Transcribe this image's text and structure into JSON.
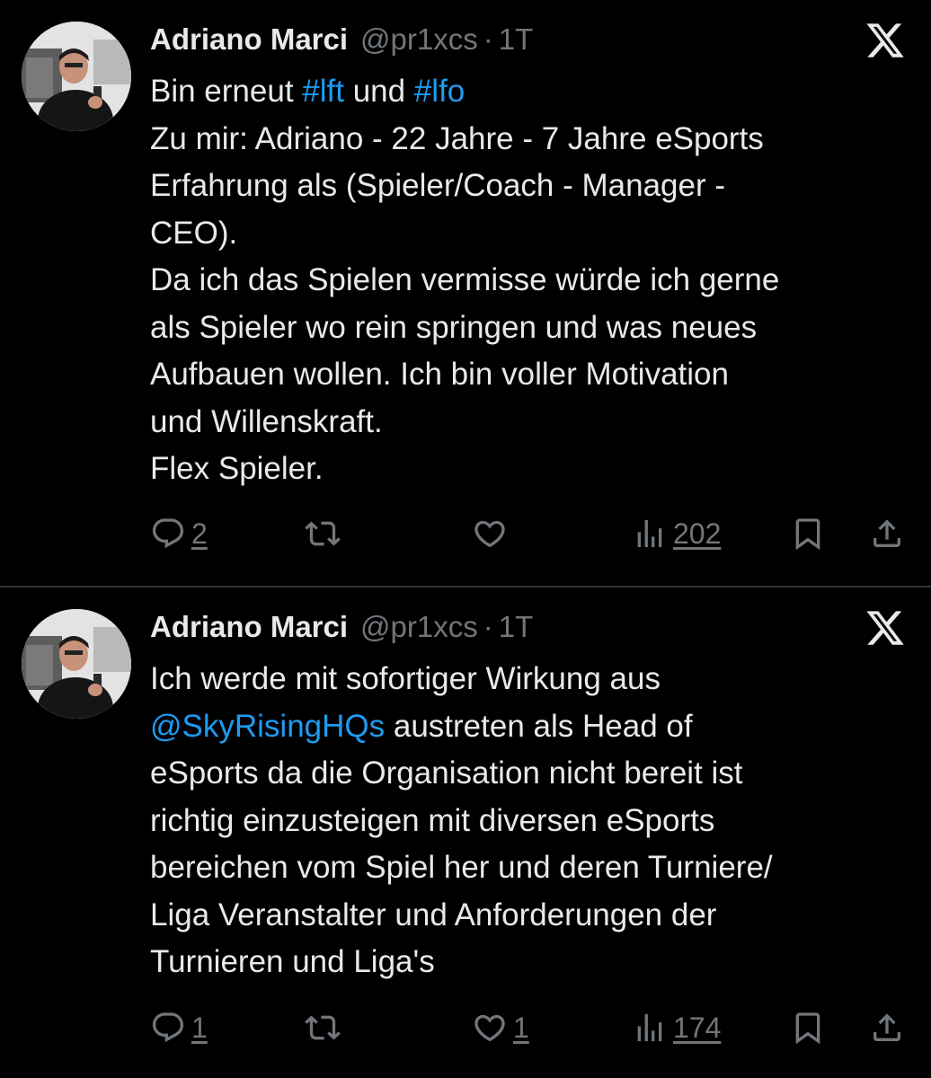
{
  "tweets": [
    {
      "author": {
        "name": "Adriano Marci",
        "handle": "@pr1xcs",
        "time": "1T",
        "separator": "·"
      },
      "body": {
        "line1_pre": "Bin erneut ",
        "line1_tag1": "#lft",
        "line1_mid": " und ",
        "line1_tag2": "#lfo",
        "lines": [
          "Zu mir: Adriano - 22 Jahre - 7 Jahre eSports",
          "Erfahrung als (Spieler/Coach - Manager -",
          "CEO).",
          "Da ich das Spielen vermisse würde ich gerne",
          "als Spieler wo rein springen und was neues",
          "Aufbauen wollen. Ich bin voller Motivation",
          "und Willenskraft.",
          "Flex Spieler."
        ]
      },
      "actions": {
        "replies": "2",
        "reposts": "",
        "likes": "",
        "views": "202"
      }
    },
    {
      "author": {
        "name": "Adriano Marci",
        "handle": "@pr1xcs",
        "time": "1T",
        "separator": "·"
      },
      "body": {
        "line1": "Ich werde mit sofortiger Wirkung aus",
        "line2_mention": "@SkyRisingHQs",
        "line2_rest": " austreten als Head of",
        "lines": [
          "eSports da die Organisation nicht bereit ist",
          "richtig einzusteigen mit diversen eSports",
          "bereichen vom Spiel her und deren Turniere/",
          "Liga Veranstalter und Anforderungen der",
          "Turnieren und Liga's"
        ]
      },
      "actions": {
        "replies": "1",
        "reposts": "",
        "likes": "1",
        "views": "174"
      }
    }
  ],
  "icons": {
    "platform": "x-logo-icon",
    "reply": "reply-icon",
    "repost": "repost-icon",
    "like": "heart-icon",
    "views": "views-chart-icon",
    "bookmark": "bookmark-icon",
    "share": "share-icon"
  },
  "colors": {
    "background": "#000000",
    "text": "#e7e9ea",
    "secondary": "#71767b",
    "link": "#1d9bf0",
    "divider": "#2f3336"
  }
}
